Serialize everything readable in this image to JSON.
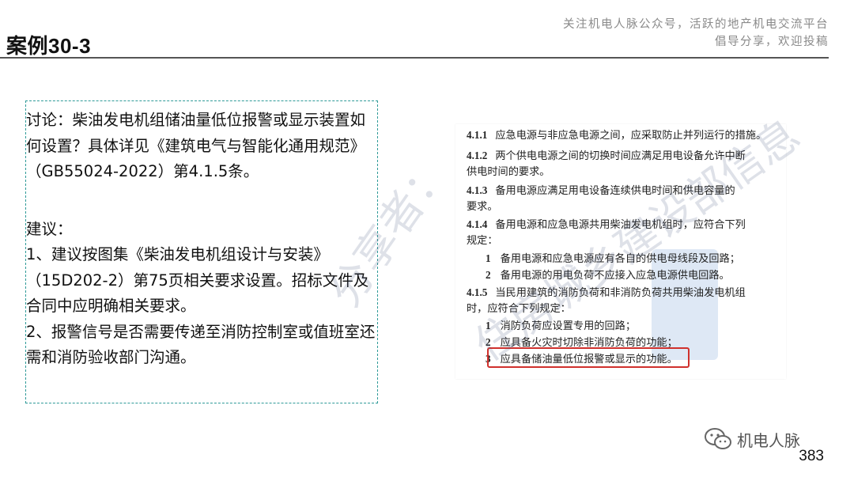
{
  "page": {
    "title": "案例30-3",
    "header_note_line1": "关注机电人脉公众号，活跃的地产机电交流平台",
    "header_note_line2": "倡导分享，欢迎投稿",
    "page_number": "383",
    "brand_name": "机电人脉",
    "brand_icon": "wechat-icon"
  },
  "discussion": {
    "paragraphs": [
      "讨论：柴油发电机组储油量低位报警或显示装置如何设置？具体详见《建筑电气与智能化通用规范》（GB55024-2022）第4.1.5条。",
      "建议：",
      "1、建议按图集《柴油发电机组设计与安装》（15D202-2）第75页相关要求设置。招标文件及合同中应明确相关要求。",
      "2、报警信号是否需要传递至消防控制室或值班室还需和消防验收部门沟通。"
    ]
  },
  "standard_excerpt": {
    "lines": [
      {
        "num": "4.1.1",
        "text": "应急电源与非应急电源之间，应采取防止并列运行的措施。"
      },
      {
        "num": "4.1.2",
        "text": "两个供电电源之间的切换时间应满足用电设备允许中断"
      },
      {
        "num": "",
        "text": "供电时间的要求。"
      },
      {
        "num": "4.1.3",
        "text": "备用电源应满足用电设备连续供电时间和供电容量的"
      },
      {
        "num": "",
        "text": "要求。"
      },
      {
        "num": "4.1.4",
        "text": "备用电源和应急电源共用柴油发电机组时，应符合下列"
      },
      {
        "num": "",
        "text": "规定："
      },
      {
        "num": "1",
        "text": "备用电源和应急电源应有各自的供电母线段及回路；"
      },
      {
        "num": "2",
        "text": "备用电源的用电负荷不应接入应急电源供电回路。"
      },
      {
        "num": "4.1.5",
        "text": "当民用建筑的消防负荷和非消防负荷共用柴油发电机组"
      },
      {
        "num": "",
        "text": "时，应符合下列规定："
      },
      {
        "num": "1",
        "text": "消防负荷应设置专用的回路；"
      },
      {
        "num": "2",
        "text": "应具备火灾时切除非消防负荷的功能；"
      },
      {
        "num": "3",
        "text": "应具备储油量低位报警或显示的功能。"
      }
    ]
  },
  "colors": {
    "dashed_border": "#2f9a98",
    "highlight": "#d0312d",
    "header_note": "#8a8a8a"
  }
}
